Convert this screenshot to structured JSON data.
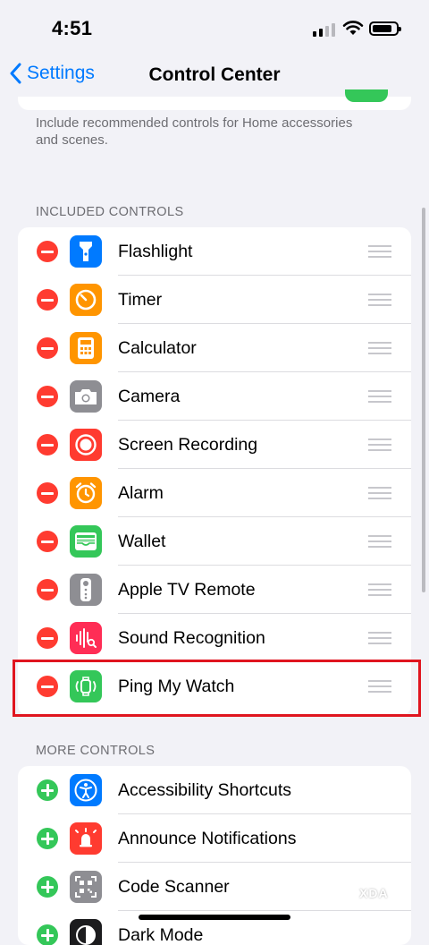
{
  "status_bar": {
    "time": "4:51"
  },
  "nav": {
    "back_label": "Settings",
    "title": "Control Center"
  },
  "footnote": "Include recommended controls for Home accessories and scenes.",
  "included_header": "INCLUDED CONTROLS",
  "included": [
    {
      "label": "Flashlight",
      "icon": "flashlight-icon",
      "color": "#007aff"
    },
    {
      "label": "Timer",
      "icon": "timer-icon",
      "color": "#ff9500"
    },
    {
      "label": "Calculator",
      "icon": "calculator-icon",
      "color": "#ff9500"
    },
    {
      "label": "Camera",
      "icon": "camera-icon",
      "color": "#8e8e93"
    },
    {
      "label": "Screen Recording",
      "icon": "record-icon",
      "color": "#ff3b30"
    },
    {
      "label": "Alarm",
      "icon": "alarm-icon",
      "color": "#ff9500"
    },
    {
      "label": "Wallet",
      "icon": "wallet-icon",
      "color": "#34c759"
    },
    {
      "label": "Apple TV Remote",
      "icon": "remote-icon",
      "color": "#8e8e93"
    },
    {
      "label": "Sound Recognition",
      "icon": "sound-recognition-icon",
      "color": "#ff2d55"
    },
    {
      "label": "Ping My Watch",
      "icon": "watch-icon",
      "color": "#34c759"
    }
  ],
  "more_header": "MORE CONTROLS",
  "more": [
    {
      "label": "Accessibility Shortcuts",
      "icon": "accessibility-icon",
      "color": "#007aff"
    },
    {
      "label": "Announce Notifications",
      "icon": "announce-icon",
      "color": "#ff3b30"
    },
    {
      "label": "Code Scanner",
      "icon": "qr-code-icon",
      "color": "#8e8e93"
    },
    {
      "label": "Dark Mode",
      "icon": "dark-mode-icon",
      "color": "#1c1c1e"
    }
  ],
  "watermark": "XDA"
}
